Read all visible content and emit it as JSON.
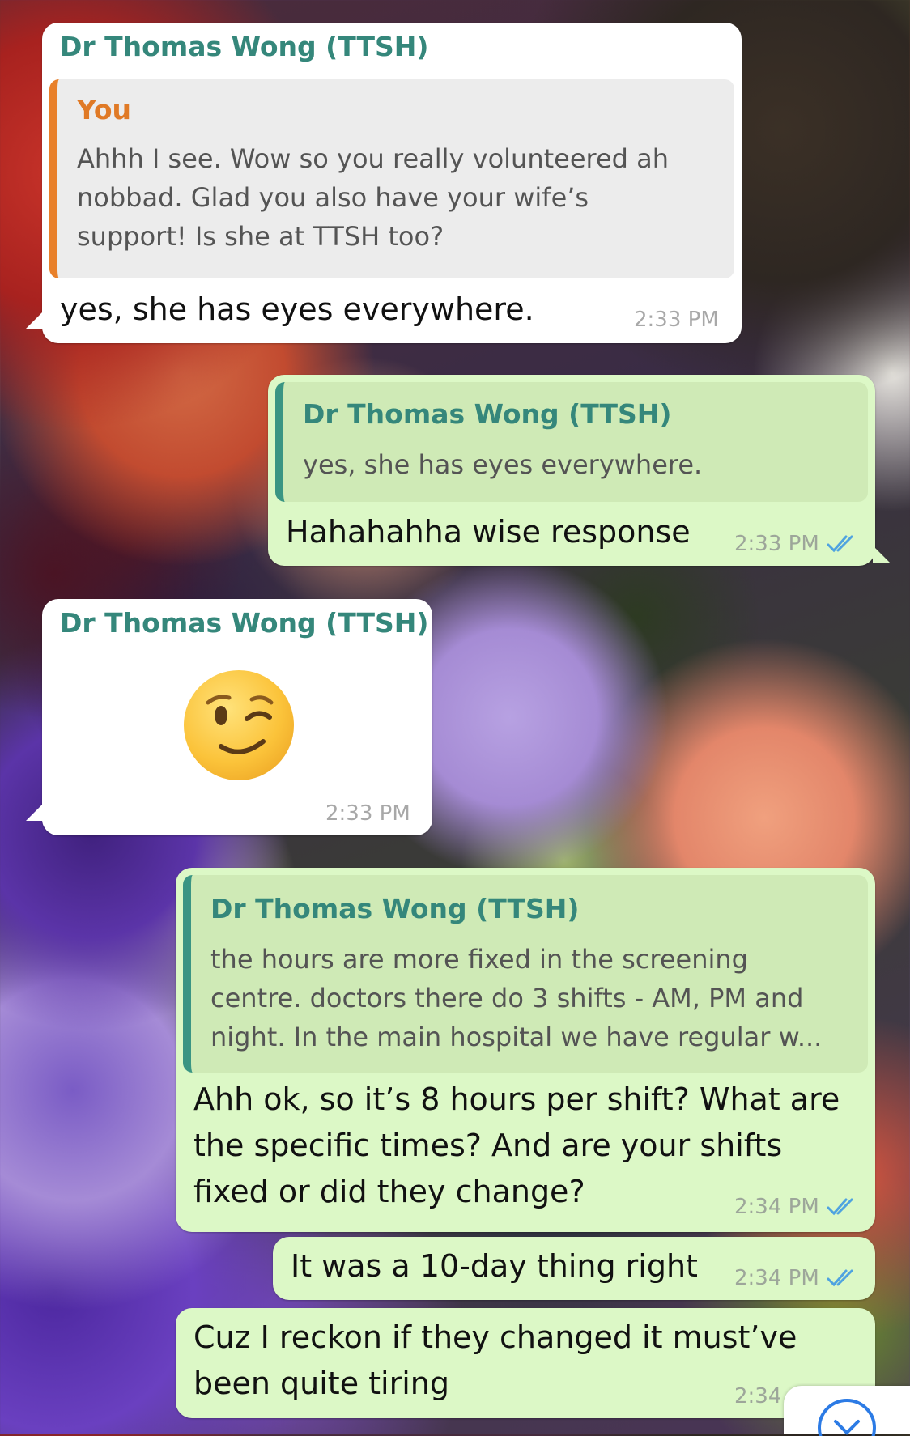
{
  "messages": [
    {
      "sender": "Dr Thomas Wong (TTSH)",
      "quote_author": "You",
      "quote_lines": [
        "Ahhh I see. Wow so you really volunteered ah",
        "nobbad. Glad you also have your wife’s",
        "support! Is she at TTSH too?"
      ],
      "text": "yes, she has eyes everywhere.",
      "time": "2:33 PM"
    },
    {
      "quote_author": "Dr Thomas Wong (TTSH)",
      "quote_lines": [
        "yes, she has eyes everywhere."
      ],
      "text": "Hahahahha wise response",
      "time": "2:33 PM"
    },
    {
      "sender": "Dr Thomas Wong (TTSH)",
      "emoji": "winking-face",
      "time": "2:33 PM"
    },
    {
      "quote_author": "Dr Thomas Wong (TTSH)",
      "quote_lines": [
        "the hours are more fixed in the screening",
        "centre. doctors there do 3 shifts - AM, PM and",
        "night. In the main hospital we have regular w..."
      ],
      "text_lines": [
        "Ahh ok, so it’s 8 hours per shift? What are",
        "the specific times? And are your shifts",
        "fixed or did they change?"
      ],
      "time": "2:34 PM"
    },
    {
      "text": "It was a 10-day thing right",
      "time": "2:34 PM"
    },
    {
      "text_lines": [
        "Cuz I reckon if they changed it must’ve",
        "been quite tiring"
      ],
      "time": "2:34"
    }
  ],
  "colors": {
    "incoming_bubble": "#ffffff",
    "outgoing_bubble": "#dcf8c6",
    "sender_name": "#35877b",
    "you_author": "#e07a26",
    "read_ticks": "#4fa3e0"
  },
  "icons": {
    "read_receipt": "double-check-icon",
    "scroll_down": "chevron-down-icon"
  }
}
